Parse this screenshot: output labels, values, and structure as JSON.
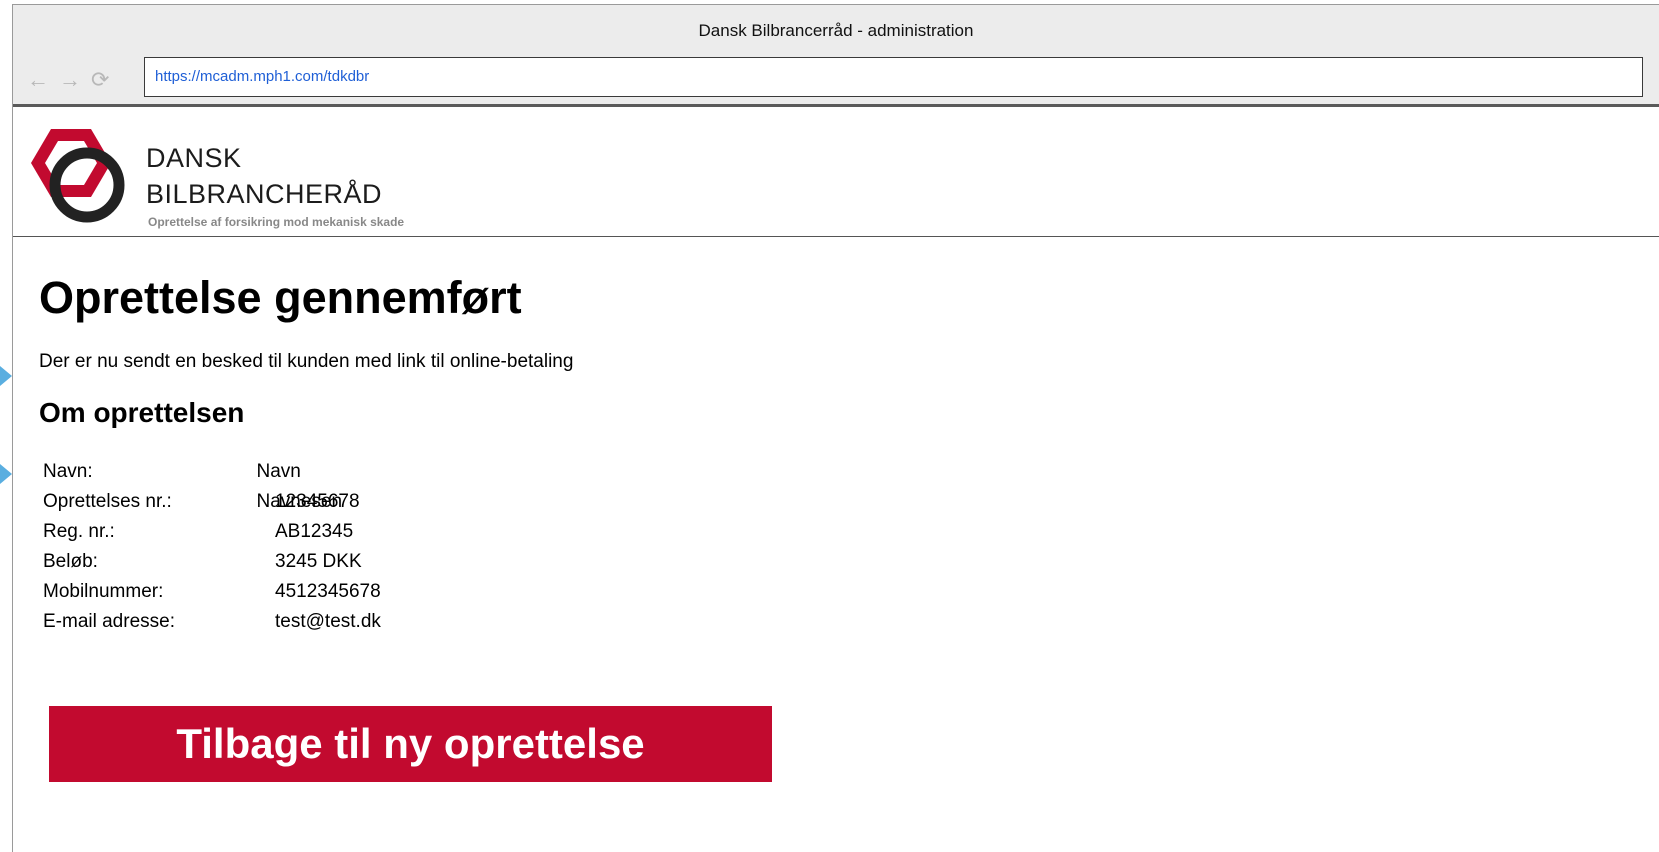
{
  "window": {
    "title": "Dansk Bilbrancerråd - administration"
  },
  "nav": {
    "back": "←",
    "forward": "→",
    "reload": "⟳"
  },
  "address_bar": {
    "url": "https://mcadm.mph1.com/tdkdbr"
  },
  "header": {
    "brand_line1": "DANSK",
    "brand_line2": "BILBRANCHERÅD",
    "tagline": "Oprettelse af forsikring mod mekanisk skade",
    "logo_icon": "dbr-logo-icon",
    "colors": {
      "logo_red": "#c20a2f",
      "logo_dark": "#222222"
    }
  },
  "main": {
    "heading": "Oprettelse gennemført",
    "message": "Der er nu sendt en besked til kunden med link til online-betaling",
    "subheading": "Om oprettelsen",
    "details": [
      {
        "label": "Navn:",
        "value": "Navn Navnesen"
      },
      {
        "label": "Oprettelses nr.:",
        "value": "12345678"
      },
      {
        "label": "Reg. nr.:",
        "value": "AB12345"
      },
      {
        "label": "Beløb:",
        "value": "3245 DKK"
      },
      {
        "label": "Mobilnummer:",
        "value": "4512345678"
      },
      {
        "label": "E-mail adresse:",
        "value": "test@test.dk"
      }
    ],
    "button_label": "Tilbage til ny oprettelse",
    "button_color": "#c20a2f"
  }
}
